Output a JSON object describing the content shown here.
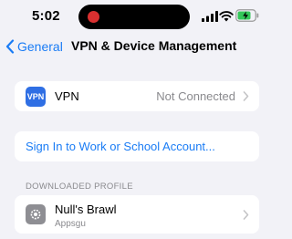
{
  "status_bar": {
    "time": "5:02"
  },
  "nav": {
    "back_label": "General",
    "title": "VPN & Device Management"
  },
  "vpn_row": {
    "icon_text": "VPN",
    "label": "VPN",
    "value": "Not Connected"
  },
  "sign_in": {
    "label": "Sign In to Work or School Account..."
  },
  "downloaded_profile": {
    "header": "DOWNLOADED PROFILE",
    "name": "Null's Brawl",
    "subtitle": "Appsgu"
  },
  "colors": {
    "accent": "#1a7cf5",
    "background": "#f2f2f7",
    "vpn_icon": "#2f6fe4",
    "secondary_text": "#8a8a8e",
    "battery_charging": "#34c759",
    "island_indicator": "#d93030"
  },
  "icons": [
    "signal-icon",
    "wifi-icon",
    "battery-charging-icon",
    "chevron-left-icon",
    "chevron-right-icon",
    "gear-icon"
  ]
}
